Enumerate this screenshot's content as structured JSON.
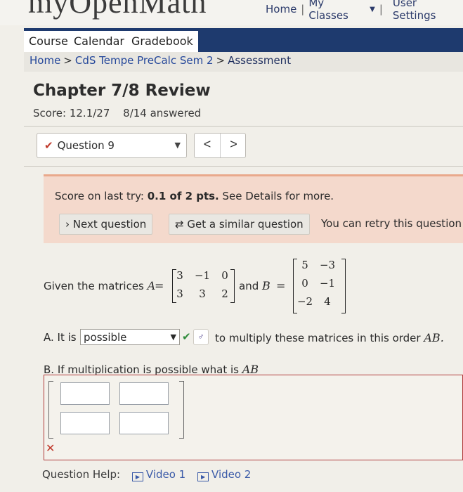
{
  "header": {
    "logo_text": "myOpenMath",
    "links": [
      "Home",
      "My Classes",
      "User Settings"
    ]
  },
  "nav": {
    "tabs": [
      "Course",
      "Calendar",
      "Gradebook"
    ]
  },
  "breadcrumb": {
    "items": [
      "Home",
      "CdS Tempe PreCalc Sem 2",
      "Assessment"
    ]
  },
  "assessment": {
    "title": "Chapter 7/8 Review",
    "score": "Score: 12.1/27",
    "answered": "8/14 answered",
    "question_label": "Question 9"
  },
  "alert": {
    "prefix": "Score on last try: ",
    "score": "0.1 of 2 pts.",
    "suffix": " See Details for more.",
    "next_button": "Next question",
    "similar_button": "Get a similar question",
    "retry_text": "You can retry this question"
  },
  "question": {
    "given_text": "Given the matrices",
    "matrix_a_name": "A",
    "matrix_a": [
      [
        "3",
        "−1",
        "0"
      ],
      [
        "3",
        "3",
        "2"
      ]
    ],
    "and_text": "and",
    "matrix_b_name": "B",
    "matrix_b": [
      [
        "5",
        "−3"
      ],
      [
        "0",
        "−1"
      ],
      [
        "−2",
        "4"
      ]
    ],
    "part_a_prefix": "A. It is",
    "part_a_selected": "possible",
    "part_a_suffix": "to multiply these matrices in this order",
    "order": "AB.",
    "part_b": "B. If multiplication is possible what is",
    "part_b_var": "AB"
  },
  "help": {
    "label": "Question Help:",
    "videos": [
      "Video 1",
      "Video 2"
    ]
  },
  "colors": {
    "navbar": "#1e3a6e",
    "alert_bg": "#f4d9cc",
    "link": "#24479a",
    "wrong": "#c0392b",
    "correct": "#2e8b3a"
  }
}
